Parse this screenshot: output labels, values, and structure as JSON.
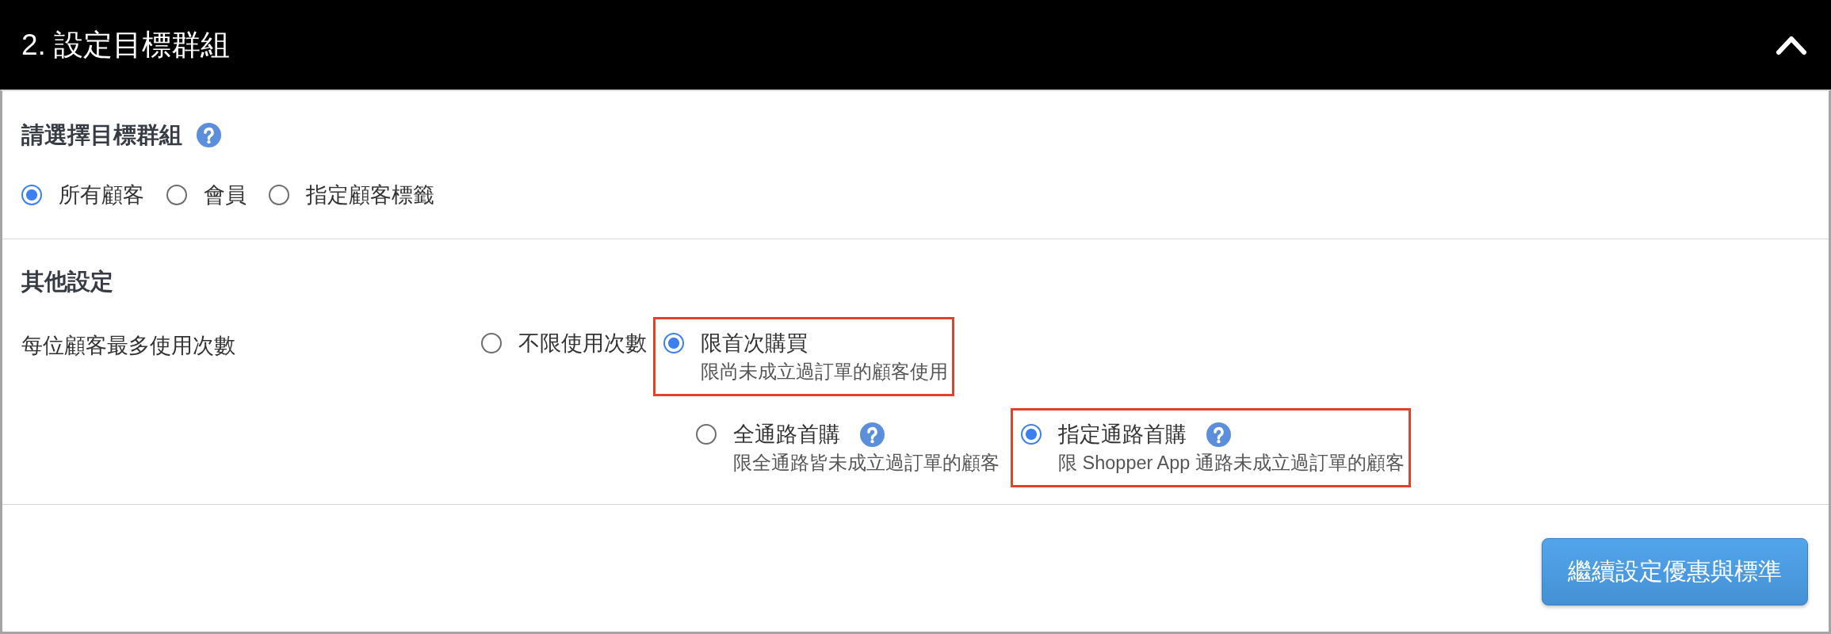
{
  "section": {
    "title": "2. 設定目標群組",
    "expanded": true
  },
  "target_group": {
    "heading": "請選擇目標群組",
    "help": true,
    "options": [
      {
        "label": "所有顧客",
        "selected": true
      },
      {
        "label": "會員",
        "selected": false
      },
      {
        "label": "指定顧客標籤",
        "selected": false
      }
    ]
  },
  "other_settings": {
    "heading": "其他設定",
    "usage_limit": {
      "label": "每位顧客最多使用次數",
      "options": [
        {
          "label": "不限使用次數",
          "help": false,
          "selected": false,
          "highlighted": false
        },
        {
          "label": "限首次購買",
          "description": "限尚未成立過訂單的顧客使用",
          "help": false,
          "selected": true,
          "highlighted": true
        }
      ],
      "sub_options": [
        {
          "label": "全通路首購",
          "description": "限全通路皆未成立過訂單的顧客",
          "help": true,
          "selected": false,
          "highlighted": false
        },
        {
          "label": "指定通路首購",
          "description": "限 Shopper App 通路未成立過訂單的顧客",
          "help": true,
          "selected": true,
          "highlighted": true
        }
      ]
    }
  },
  "actions": {
    "continue_button": "繼續設定優惠與標準"
  }
}
